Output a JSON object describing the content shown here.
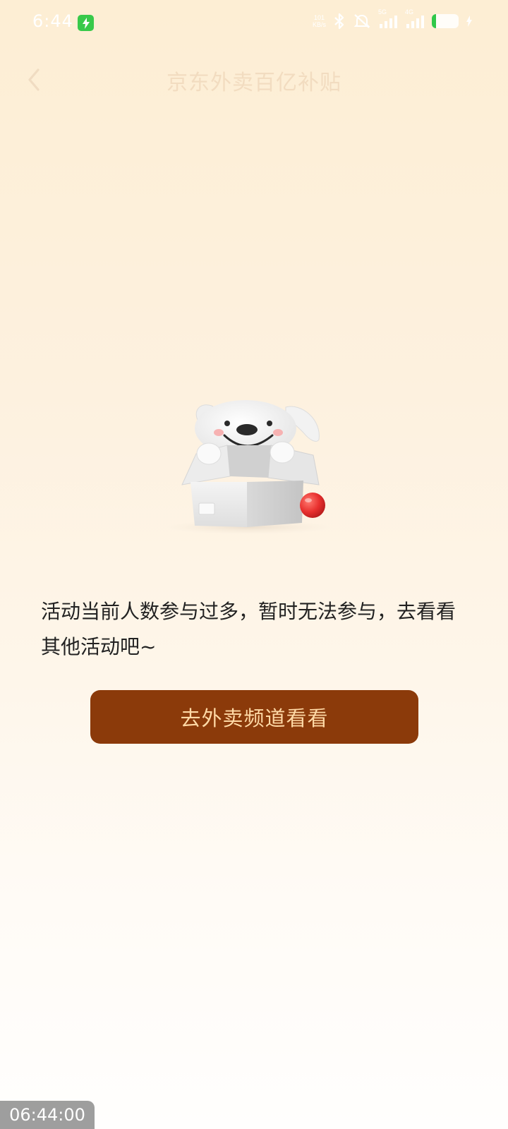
{
  "status_bar": {
    "time": "6:44",
    "net_speed_value": "101",
    "net_speed_unit": "KB/s",
    "signal_label_1": "5G",
    "signal_label_2": "4G",
    "icons": [
      "charging-badge-icon",
      "bluetooth-icon",
      "mute-icon",
      "signal-5g-icon",
      "signal-4g-icon",
      "battery-icon",
      "charging-bolt-icon"
    ]
  },
  "nav": {
    "title": "京东外卖百亿补贴",
    "back_icon": "chevron-left-icon"
  },
  "illustration": {
    "icon": "mascot-dog-in-box-icon"
  },
  "message": {
    "text": "活动当前人数参与过多，暂时无法参与，去看看其他活动吧~"
  },
  "cta": {
    "label": "去外卖频道看看"
  },
  "timestamp_overlay": {
    "text": "06:44:00"
  },
  "colors": {
    "background_top": "#fdeed4",
    "background_bottom": "#fffefd",
    "cta_background": "#8b3a0a",
    "cta_text": "#ffd9a6",
    "message_text": "#222222",
    "nav_title": "#f2dcc0",
    "ball": "#e8302e"
  }
}
